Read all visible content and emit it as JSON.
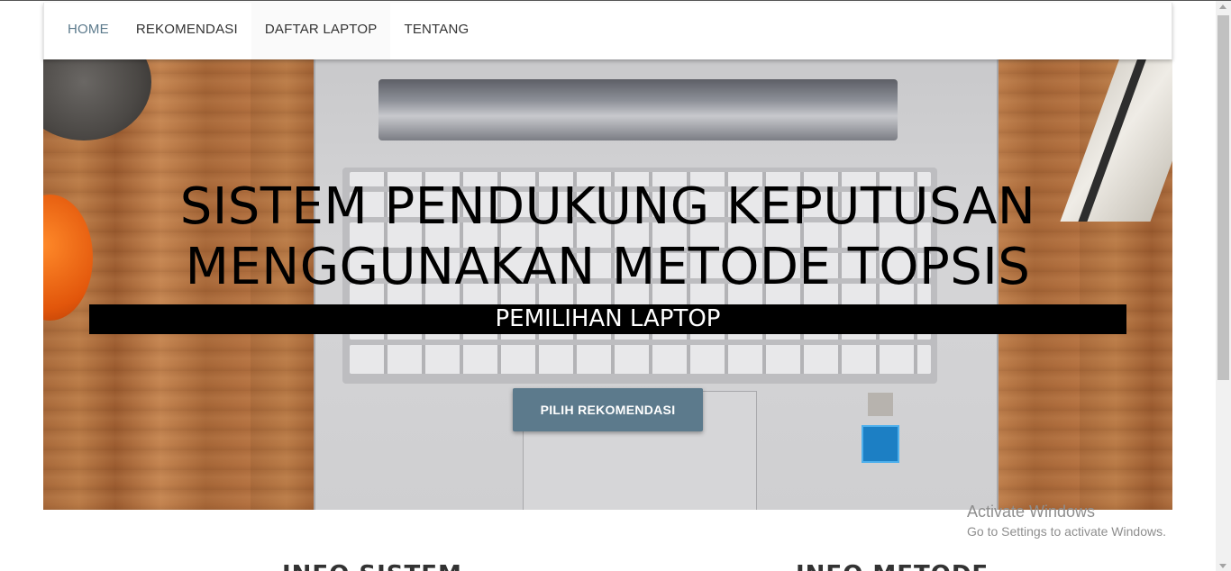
{
  "nav": {
    "items": [
      {
        "label": "HOME",
        "active": true
      },
      {
        "label": "REKOMENDASI",
        "active": false
      },
      {
        "label": "DAFTAR LAPTOP",
        "active": false
      },
      {
        "label": "TENTANG",
        "active": false
      }
    ]
  },
  "hero": {
    "title_line1": "SISTEM PENDUKUNG KEPUTUSAN",
    "title_line2": "MENGGUNAKAN METODE TOPSIS",
    "subtitle": "PEMILIHAN LAPTOP",
    "cta_label": "PILIH REKOMENDASI"
  },
  "sections": {
    "info_sistem": "INFO SISTEM",
    "info_metode": "INFO METODE"
  },
  "watermark": {
    "title": "Activate Windows",
    "subtitle": "Go to Settings to activate Windows."
  },
  "colors": {
    "accent": "#5c7a8c",
    "subtitle_bg": "#000000",
    "nav_bg": "#ffffff"
  }
}
